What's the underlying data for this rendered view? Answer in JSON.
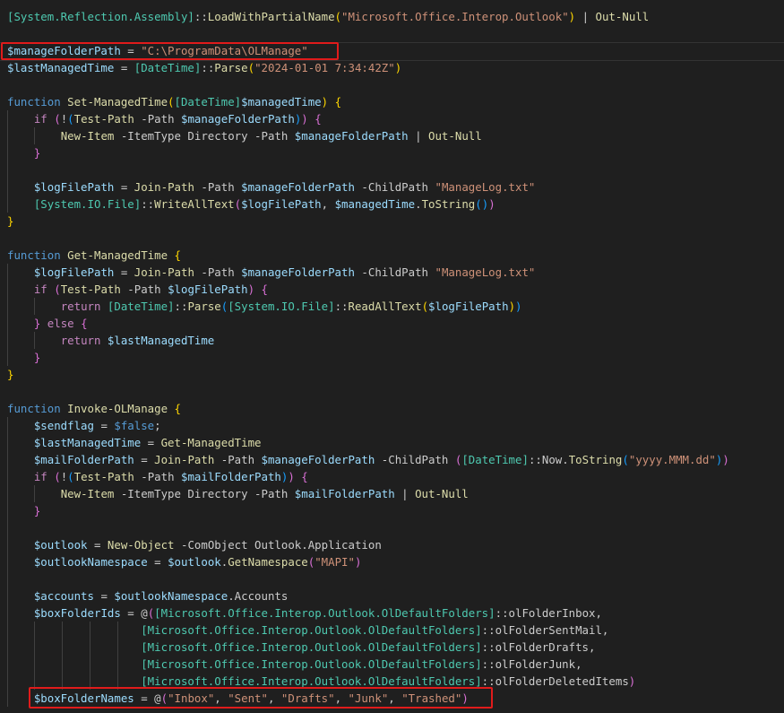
{
  "editor": {
    "language": "powershell",
    "highlighted_lines": [
      2,
      41
    ],
    "lines": [
      [
        [
          "[System.Reflection.Assembly]",
          "t"
        ],
        [
          "::",
          "p"
        ],
        [
          "LoadWithPartialName",
          "f"
        ],
        [
          "(",
          "b1"
        ],
        [
          "\"Microsoft.Office.Interop.Outlook\"",
          "s"
        ],
        [
          ")",
          "b1"
        ],
        [
          " | ",
          "p"
        ],
        [
          "Out-Null",
          "f"
        ]
      ],
      [],
      [
        [
          "$manageFolderPath",
          "v"
        ],
        [
          " = ",
          "p"
        ],
        [
          "\"C:\\ProgramData\\OLManage\"",
          "s"
        ]
      ],
      [
        [
          "$lastManagedTime",
          "v"
        ],
        [
          " = ",
          "p"
        ],
        [
          "[DateTime]",
          "t"
        ],
        [
          "::",
          "p"
        ],
        [
          "Parse",
          "f"
        ],
        [
          "(",
          "b1"
        ],
        [
          "\"2024-01-01 7:34:42Z\"",
          "s"
        ],
        [
          ")",
          "b1"
        ]
      ],
      [],
      [
        [
          "function ",
          "kb"
        ],
        [
          "Set-ManagedTime",
          "f"
        ],
        [
          "(",
          "b1"
        ],
        [
          "[DateTime]",
          "t"
        ],
        [
          "$managedTime",
          "v"
        ],
        [
          ")",
          "b1"
        ],
        [
          " {",
          "b1"
        ]
      ],
      [
        [
          "    ",
          "p"
        ],
        [
          "if ",
          "k"
        ],
        [
          "(",
          "b2"
        ],
        [
          "!",
          "p"
        ],
        [
          "(",
          "b3"
        ],
        [
          "Test-Path",
          "f"
        ],
        [
          " -Path ",
          "p"
        ],
        [
          "$manageFolderPath",
          "v"
        ],
        [
          ")",
          "b3"
        ],
        [
          ")",
          "b2"
        ],
        [
          " {",
          "b2"
        ]
      ],
      [
        [
          "        ",
          "p"
        ],
        [
          "New-Item",
          "f"
        ],
        [
          " -ItemType Directory -Path ",
          "p"
        ],
        [
          "$manageFolderPath",
          "v"
        ],
        [
          " | ",
          "p"
        ],
        [
          "Out-Null",
          "f"
        ]
      ],
      [
        [
          "    ",
          "p"
        ],
        [
          "}",
          "b2"
        ]
      ],
      [],
      [
        [
          "    ",
          "p"
        ],
        [
          "$logFilePath",
          "v"
        ],
        [
          " = ",
          "p"
        ],
        [
          "Join-Path",
          "f"
        ],
        [
          " -Path ",
          "p"
        ],
        [
          "$manageFolderPath",
          "v"
        ],
        [
          " -ChildPath ",
          "p"
        ],
        [
          "\"ManageLog.txt\"",
          "s"
        ]
      ],
      [
        [
          "    ",
          "p"
        ],
        [
          "[System.IO.File]",
          "t"
        ],
        [
          "::",
          "p"
        ],
        [
          "WriteAllText",
          "f"
        ],
        [
          "(",
          "b2"
        ],
        [
          "$logFilePath",
          "v"
        ],
        [
          ", ",
          "p"
        ],
        [
          "$managedTime",
          "v"
        ],
        [
          ".",
          "p"
        ],
        [
          "ToString",
          "f"
        ],
        [
          "(",
          "b3"
        ],
        [
          ")",
          "b3"
        ],
        [
          ")",
          "b2"
        ]
      ],
      [
        [
          "}",
          "b1"
        ]
      ],
      [],
      [
        [
          "function ",
          "kb"
        ],
        [
          "Get-ManagedTime",
          "f"
        ],
        [
          " {",
          "b1"
        ]
      ],
      [
        [
          "    ",
          "p"
        ],
        [
          "$logFilePath",
          "v"
        ],
        [
          " = ",
          "p"
        ],
        [
          "Join-Path",
          "f"
        ],
        [
          " -Path ",
          "p"
        ],
        [
          "$manageFolderPath",
          "v"
        ],
        [
          " -ChildPath ",
          "p"
        ],
        [
          "\"ManageLog.txt\"",
          "s"
        ]
      ],
      [
        [
          "    ",
          "p"
        ],
        [
          "if ",
          "k"
        ],
        [
          "(",
          "b2"
        ],
        [
          "Test-Path",
          "f"
        ],
        [
          " -Path ",
          "p"
        ],
        [
          "$logFilePath",
          "v"
        ],
        [
          ")",
          "b2"
        ],
        [
          " {",
          "b2"
        ]
      ],
      [
        [
          "        ",
          "p"
        ],
        [
          "return ",
          "k"
        ],
        [
          "[DateTime]",
          "t"
        ],
        [
          "::",
          "p"
        ],
        [
          "Parse",
          "f"
        ],
        [
          "(",
          "b3"
        ],
        [
          "[System.IO.File]",
          "t"
        ],
        [
          "::",
          "p"
        ],
        [
          "ReadAllText",
          "f"
        ],
        [
          "(",
          "b1"
        ],
        [
          "$logFilePath",
          "v"
        ],
        [
          ")",
          "b1"
        ],
        [
          ")",
          "b3"
        ]
      ],
      [
        [
          "    ",
          "p"
        ],
        [
          "}",
          "b2"
        ],
        [
          " else ",
          "k"
        ],
        [
          "{",
          "b2"
        ]
      ],
      [
        [
          "        ",
          "p"
        ],
        [
          "return ",
          "k"
        ],
        [
          "$lastManagedTime",
          "v"
        ]
      ],
      [
        [
          "    ",
          "p"
        ],
        [
          "}",
          "b2"
        ]
      ],
      [
        [
          "}",
          "b1"
        ]
      ],
      [],
      [
        [
          "function ",
          "kb"
        ],
        [
          "Invoke-OLManage",
          "f"
        ],
        [
          " {",
          "b1"
        ]
      ],
      [
        [
          "    ",
          "p"
        ],
        [
          "$sendflag",
          "v"
        ],
        [
          " = ",
          "p"
        ],
        [
          "$false",
          "kb"
        ],
        [
          ";",
          "p"
        ]
      ],
      [
        [
          "    ",
          "p"
        ],
        [
          "$lastManagedTime",
          "v"
        ],
        [
          " = ",
          "p"
        ],
        [
          "Get-ManagedTime",
          "f"
        ]
      ],
      [
        [
          "    ",
          "p"
        ],
        [
          "$mailFolderPath",
          "v"
        ],
        [
          " = ",
          "p"
        ],
        [
          "Join-Path",
          "f"
        ],
        [
          " -Path ",
          "p"
        ],
        [
          "$manageFolderPath",
          "v"
        ],
        [
          " -ChildPath ",
          "p"
        ],
        [
          "(",
          "b2"
        ],
        [
          "[DateTime]",
          "t"
        ],
        [
          "::",
          "p"
        ],
        [
          "Now",
          "p"
        ],
        [
          ".",
          "p"
        ],
        [
          "ToString",
          "f"
        ],
        [
          "(",
          "b3"
        ],
        [
          "\"yyyy.MMM.dd\"",
          "s"
        ],
        [
          ")",
          "b3"
        ],
        [
          ")",
          "b2"
        ]
      ],
      [
        [
          "    ",
          "p"
        ],
        [
          "if ",
          "k"
        ],
        [
          "(",
          "b2"
        ],
        [
          "!",
          "p"
        ],
        [
          "(",
          "b3"
        ],
        [
          "Test-Path",
          "f"
        ],
        [
          " -Path ",
          "p"
        ],
        [
          "$mailFolderPath",
          "v"
        ],
        [
          ")",
          "b3"
        ],
        [
          ")",
          "b2"
        ],
        [
          " {",
          "b2"
        ]
      ],
      [
        [
          "        ",
          "p"
        ],
        [
          "New-Item",
          "f"
        ],
        [
          " -ItemType Directory -Path ",
          "p"
        ],
        [
          "$mailFolderPath",
          "v"
        ],
        [
          " | ",
          "p"
        ],
        [
          "Out-Null",
          "f"
        ]
      ],
      [
        [
          "    ",
          "p"
        ],
        [
          "}",
          "b2"
        ]
      ],
      [],
      [
        [
          "    ",
          "p"
        ],
        [
          "$outlook",
          "v"
        ],
        [
          " = ",
          "p"
        ],
        [
          "New-Object",
          "f"
        ],
        [
          " -ComObject Outlook.Application",
          "p"
        ]
      ],
      [
        [
          "    ",
          "p"
        ],
        [
          "$outlookNamespace",
          "v"
        ],
        [
          " = ",
          "p"
        ],
        [
          "$outlook",
          "v"
        ],
        [
          ".",
          "p"
        ],
        [
          "GetNamespace",
          "f"
        ],
        [
          "(",
          "b2"
        ],
        [
          "\"MAPI\"",
          "s"
        ],
        [
          ")",
          "b2"
        ]
      ],
      [],
      [
        [
          "    ",
          "p"
        ],
        [
          "$accounts",
          "v"
        ],
        [
          " = ",
          "p"
        ],
        [
          "$outlookNamespace",
          "v"
        ],
        [
          ".Accounts",
          "p"
        ]
      ],
      [
        [
          "    ",
          "p"
        ],
        [
          "$boxFolderIds",
          "v"
        ],
        [
          " = ",
          "p"
        ],
        [
          "@",
          "p"
        ],
        [
          "(",
          "b2"
        ],
        [
          "[Microsoft.Office.Interop.Outlook.OlDefaultFolders]",
          "t"
        ],
        [
          "::",
          "p"
        ],
        [
          "olFolderInbox,",
          "p"
        ]
      ],
      [
        [
          "                    ",
          "p"
        ],
        [
          "[Microsoft.Office.Interop.Outlook.OlDefaultFolders]",
          "t"
        ],
        [
          "::",
          "p"
        ],
        [
          "olFolderSentMail,",
          "p"
        ]
      ],
      [
        [
          "                    ",
          "p"
        ],
        [
          "[Microsoft.Office.Interop.Outlook.OlDefaultFolders]",
          "t"
        ],
        [
          "::",
          "p"
        ],
        [
          "olFolderDrafts,",
          "p"
        ]
      ],
      [
        [
          "                    ",
          "p"
        ],
        [
          "[Microsoft.Office.Interop.Outlook.OlDefaultFolders]",
          "t"
        ],
        [
          "::",
          "p"
        ],
        [
          "olFolderJunk,",
          "p"
        ]
      ],
      [
        [
          "                    ",
          "p"
        ],
        [
          "[Microsoft.Office.Interop.Outlook.OlDefaultFolders]",
          "t"
        ],
        [
          "::",
          "p"
        ],
        [
          "olFolderDeletedItems",
          "p"
        ],
        [
          ")",
          "b2"
        ]
      ],
      [
        [
          "    ",
          "p"
        ],
        [
          "$boxFolderNames",
          "v"
        ],
        [
          " = ",
          "p"
        ],
        [
          "@",
          "p"
        ],
        [
          "(",
          "b2"
        ],
        [
          "\"Inbox\"",
          "s"
        ],
        [
          ", ",
          "p"
        ],
        [
          "\"Sent\"",
          "s"
        ],
        [
          ", ",
          "p"
        ],
        [
          "\"Drafts\"",
          "s"
        ],
        [
          ", ",
          "p"
        ],
        [
          "\"Junk\"",
          "s"
        ],
        [
          ", ",
          "p"
        ],
        [
          "\"Trashed\"",
          "s"
        ],
        [
          ")",
          "b2"
        ]
      ]
    ]
  }
}
